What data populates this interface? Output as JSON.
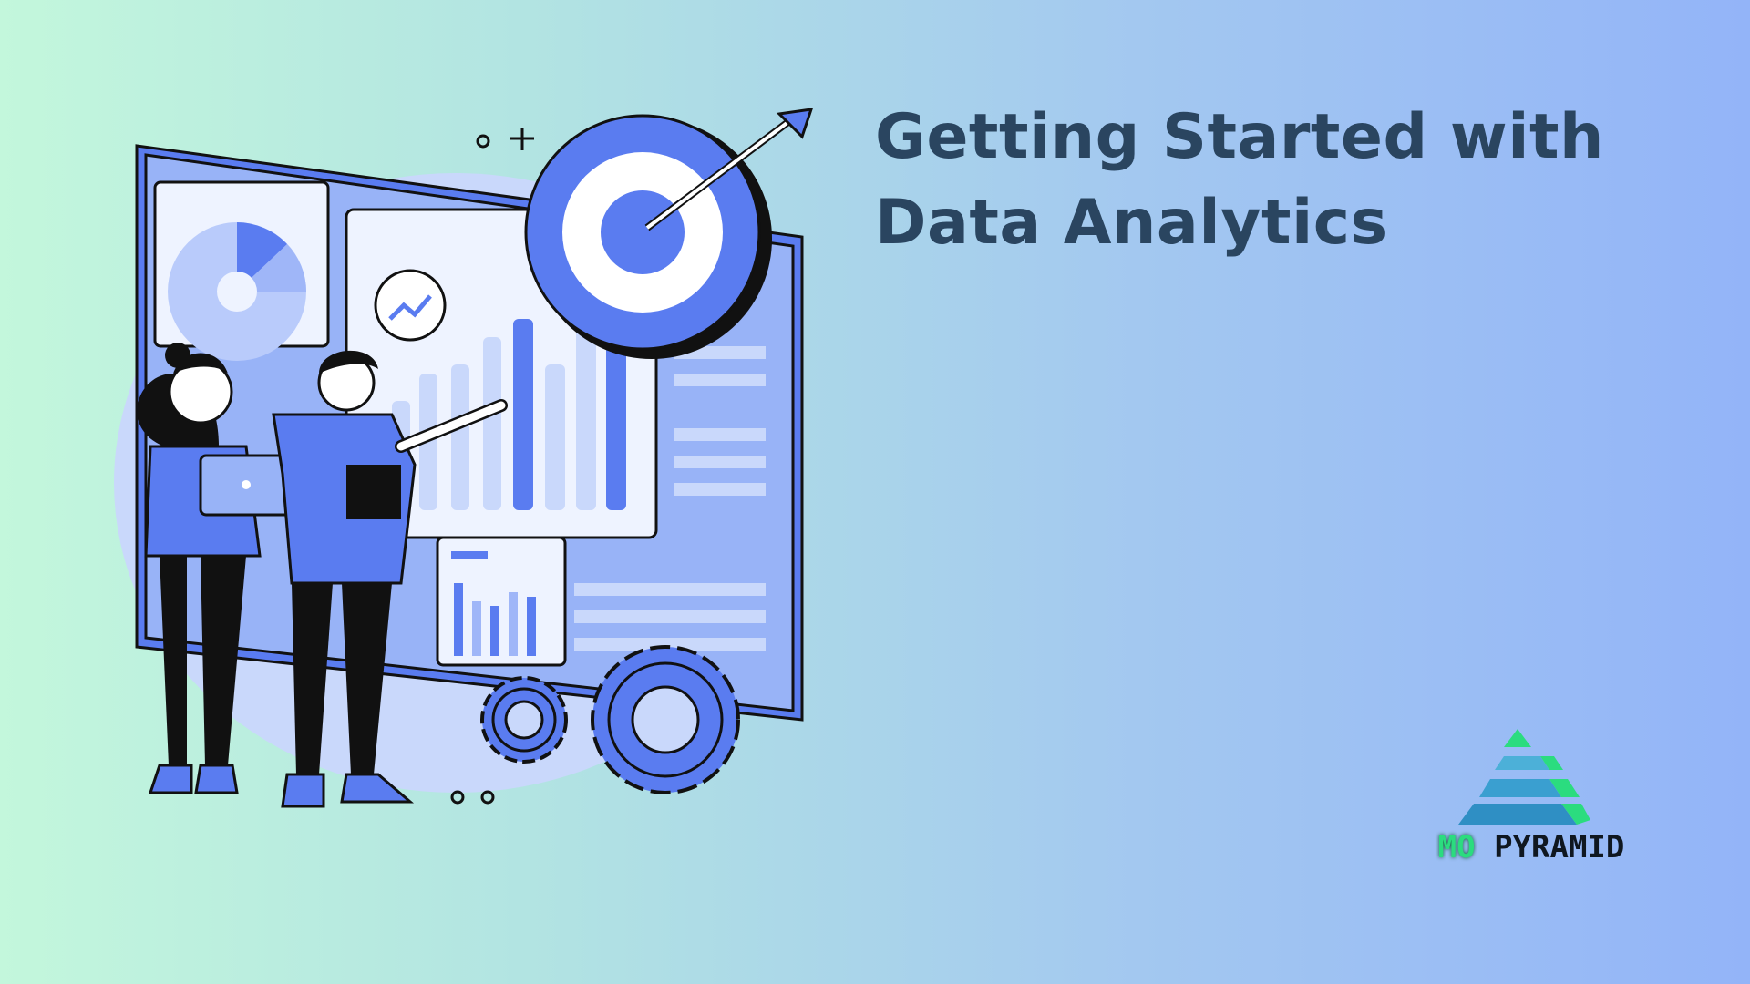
{
  "headline": {
    "line1": "Getting Started with",
    "line2": "Data Analytics"
  },
  "brand": {
    "part1": "MO",
    "part2": "PYRAMID"
  },
  "colors": {
    "background_left": "#c3f7dc",
    "background_right": "#93b4f8",
    "headline": "#2a4560",
    "illustration_blue": "#5a7cf0",
    "illustration_light": "#c9d8fb",
    "brand_green": "#2bdc7f"
  }
}
